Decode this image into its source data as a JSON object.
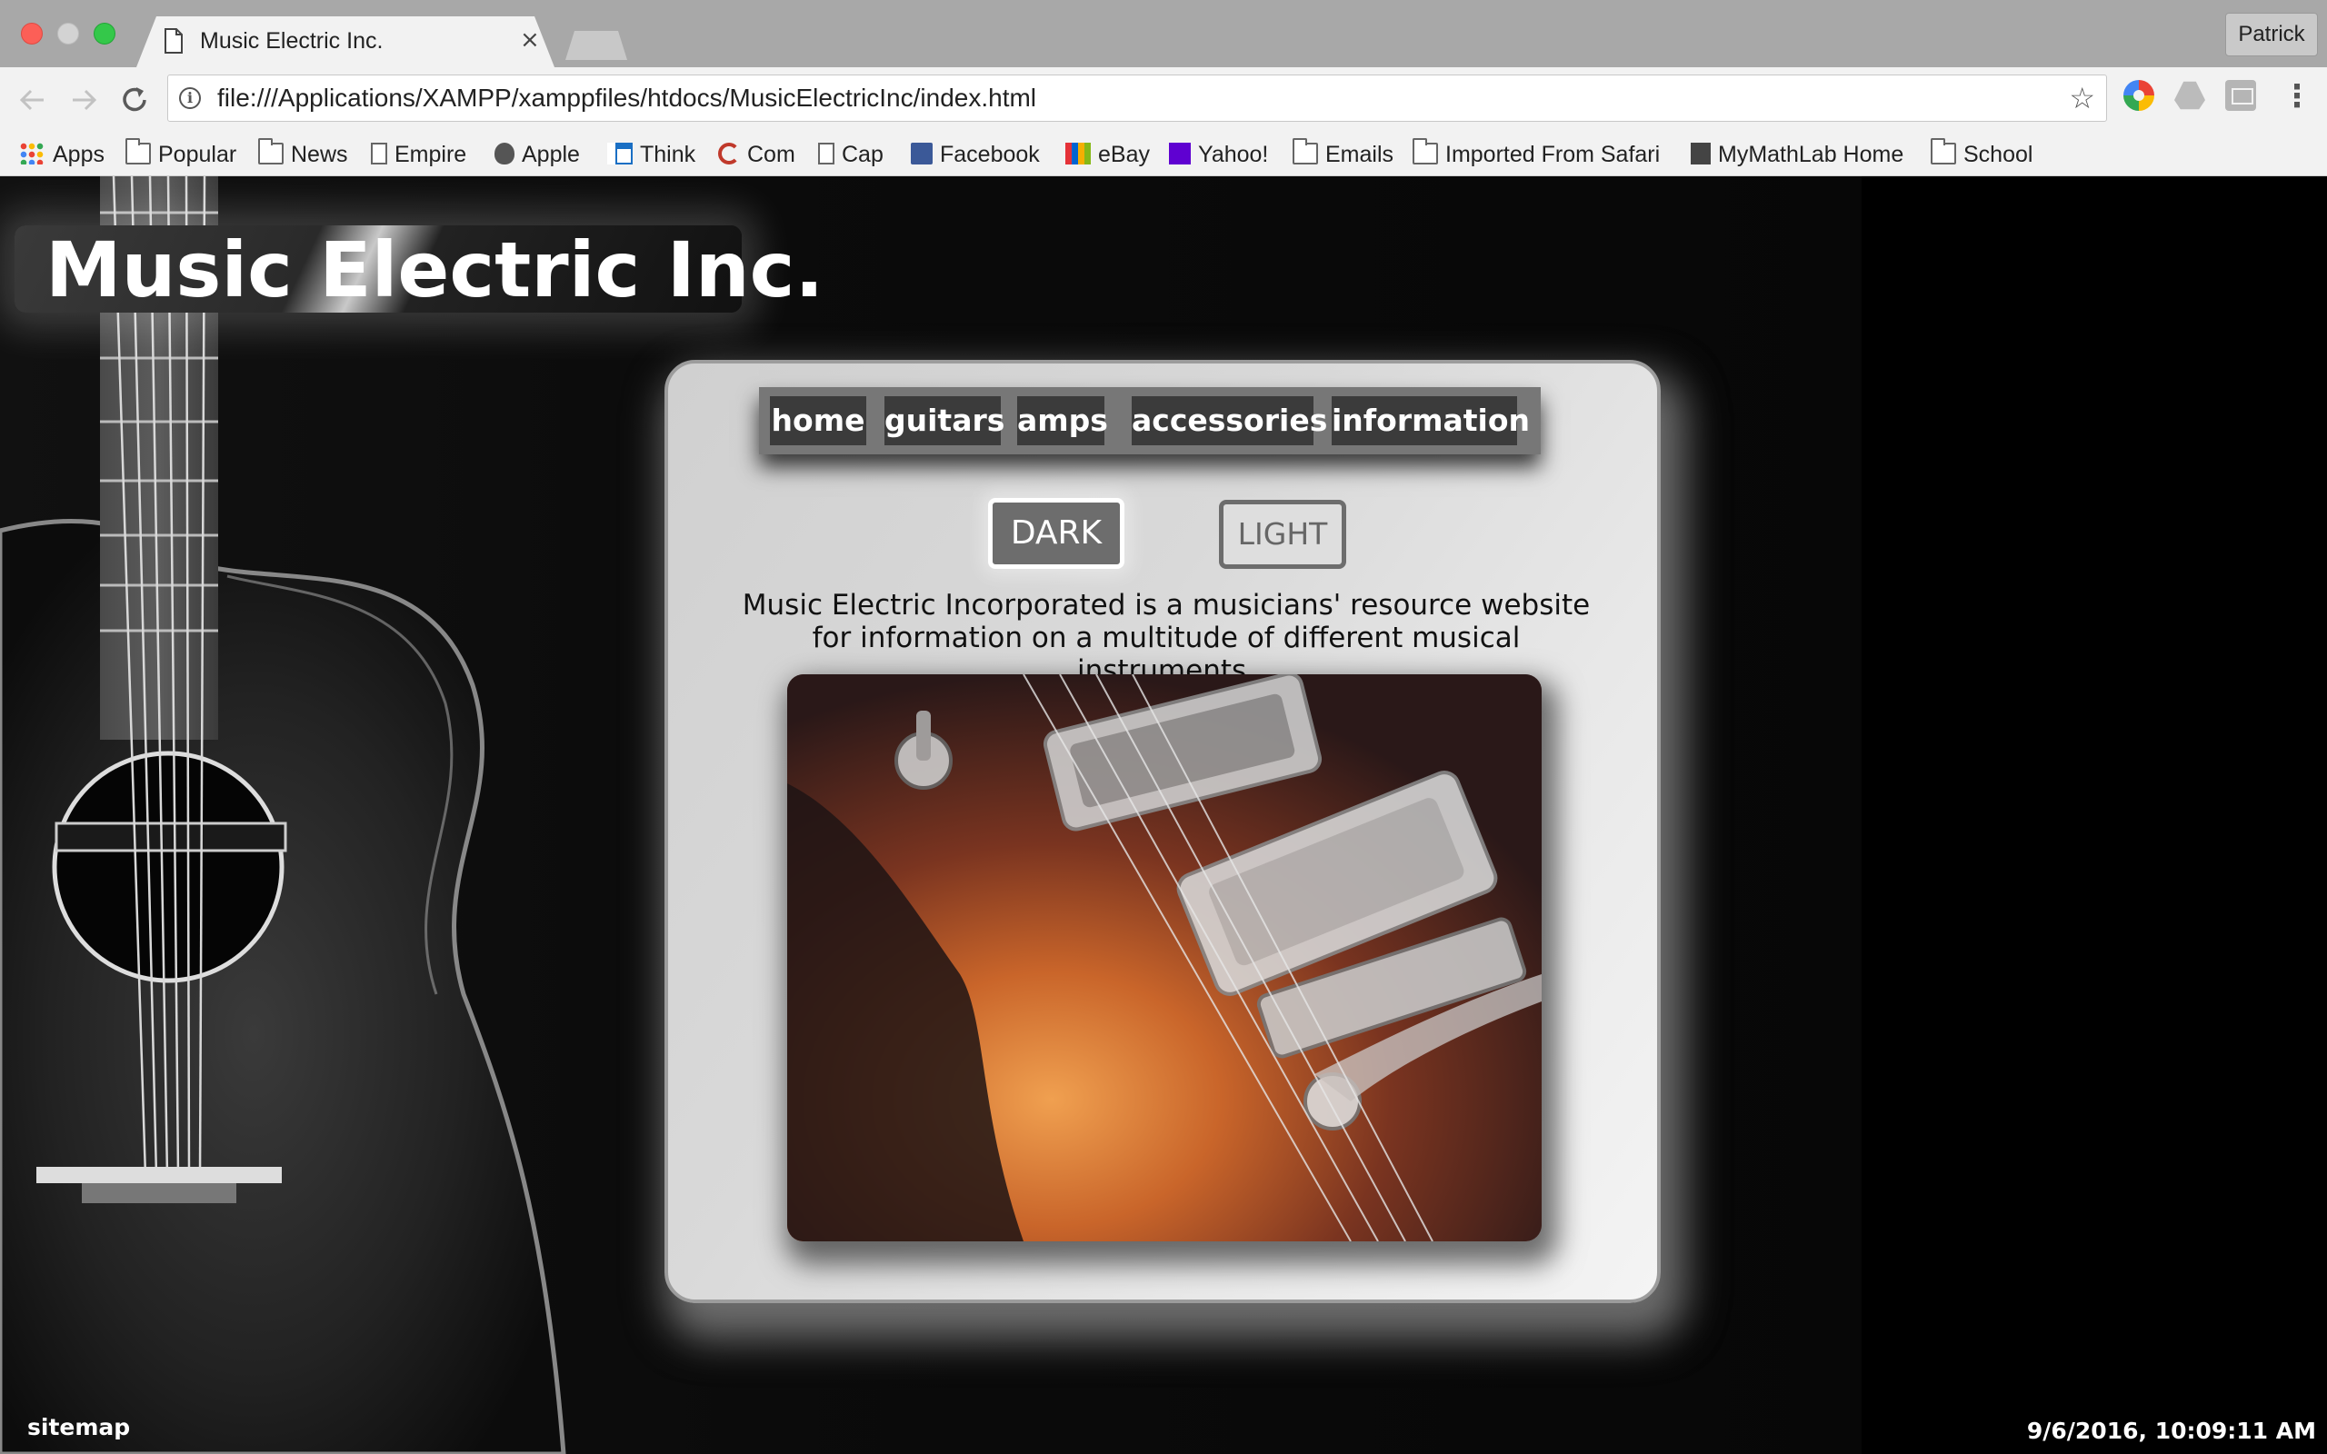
{
  "browser": {
    "tab_title": "Music Electric Inc.",
    "tab_close": "×",
    "profile_name": "Patrick",
    "url": "file:///Applications/XAMPP/xamppfiles/htdocs/MusicElectricInc/index.html",
    "bookmarks": [
      {
        "label": "Apps",
        "icon": "apps-grid-icon"
      },
      {
        "label": "Popular",
        "icon": "folder-icon"
      },
      {
        "label": "News",
        "icon": "folder-icon"
      },
      {
        "label": "Empire",
        "icon": "page-icon"
      },
      {
        "label": "Apple",
        "icon": "apple-icon"
      },
      {
        "label": "Think",
        "icon": "think-icon"
      },
      {
        "label": "Com",
        "icon": "com-icon"
      },
      {
        "label": "Cap",
        "icon": "page-icon"
      },
      {
        "label": "Facebook",
        "icon": "facebook-icon"
      },
      {
        "label": "eBay",
        "icon": "ebay-icon"
      },
      {
        "label": "Yahoo!",
        "icon": "yahoo-icon"
      },
      {
        "label": "Emails",
        "icon": "folder-icon"
      },
      {
        "label": "Imported From Safari",
        "icon": "folder-icon"
      },
      {
        "label": "MyMathLab Home",
        "icon": "mymathlab-icon"
      },
      {
        "label": "School",
        "icon": "folder-icon"
      }
    ]
  },
  "site": {
    "title": "Music Electric Inc.",
    "nav": [
      "home",
      "guitars",
      "amps",
      "accessories",
      "information"
    ],
    "theme_dark": "DARK",
    "theme_light": "LIGHT",
    "intro": "Music Electric Incorporated is a musicians' resource website for information on a multitude of different musical instruments.",
    "sitemap": "sitemap",
    "timestamp": "9/6/2016, 10:09:11 AM"
  },
  "colors": {
    "page_bg": "#000000",
    "panel_bg": "#e0e0e0",
    "nav_link_bg": "#3b3b3b",
    "nav_bar_bg": "#777777",
    "dark_button_bg": "#6d6d6d"
  }
}
